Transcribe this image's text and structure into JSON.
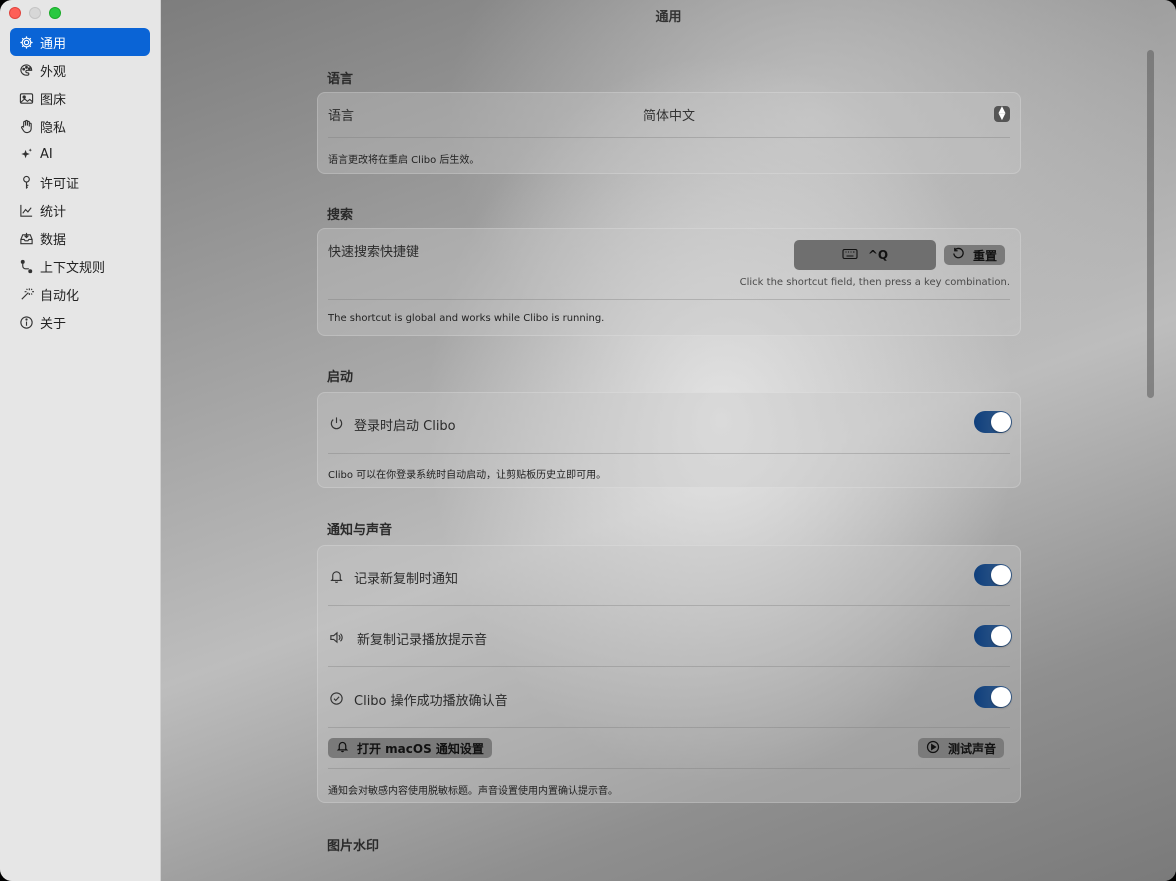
{
  "window": {
    "title": "通用"
  },
  "sidebar": {
    "items": [
      {
        "label": "通用",
        "icon": "gear-icon",
        "active": true
      },
      {
        "label": "外观",
        "icon": "palette-icon"
      },
      {
        "label": "图床",
        "icon": "image-icon"
      },
      {
        "label": "隐私",
        "icon": "hand-icon"
      },
      {
        "label": "AI",
        "icon": "sparkles-icon"
      },
      {
        "label": "许可证",
        "icon": "key-icon"
      },
      {
        "label": "统计",
        "icon": "chart-icon"
      },
      {
        "label": "数据",
        "icon": "tray-icon"
      },
      {
        "label": "上下文规则",
        "icon": "branch-icon"
      },
      {
        "label": "自动化",
        "icon": "wand-icon"
      },
      {
        "label": "关于",
        "icon": "info-icon"
      }
    ]
  },
  "language": {
    "title": "语言",
    "label": "语言",
    "value": "简体中文",
    "note": "语言更改将在重启 Clibo 后生效。"
  },
  "search": {
    "title": "搜索",
    "label": "快速搜索快捷键",
    "shortcut": "^Q",
    "reset_label": "重置",
    "hint": "Click the shortcut field, then press a key combination.",
    "note": "The shortcut is global and works while Clibo is running."
  },
  "startup": {
    "title": "启动",
    "label": "登录时启动 Clibo",
    "enabled": true,
    "note": "Clibo 可以在你登录系统时自动启动，让剪贴板历史立即可用。"
  },
  "notify": {
    "title": "通知与声音",
    "items": [
      {
        "label": "记录新复制时通知",
        "icon": "bell-icon",
        "enabled": true
      },
      {
        "label": "新复制记录播放提示音",
        "icon": "speaker-icon",
        "enabled": true
      },
      {
        "label": "Clibo 操作成功播放确认音",
        "icon": "checkmark-circle-icon",
        "enabled": true
      }
    ],
    "open_settings_label": "打开 macOS 通知设置",
    "test_sound_label": "测试声音",
    "note": "通知会对敏感内容使用脱敏标题。声音设置使用内置确认提示音。"
  },
  "watermark": {
    "title": "图片水印"
  }
}
